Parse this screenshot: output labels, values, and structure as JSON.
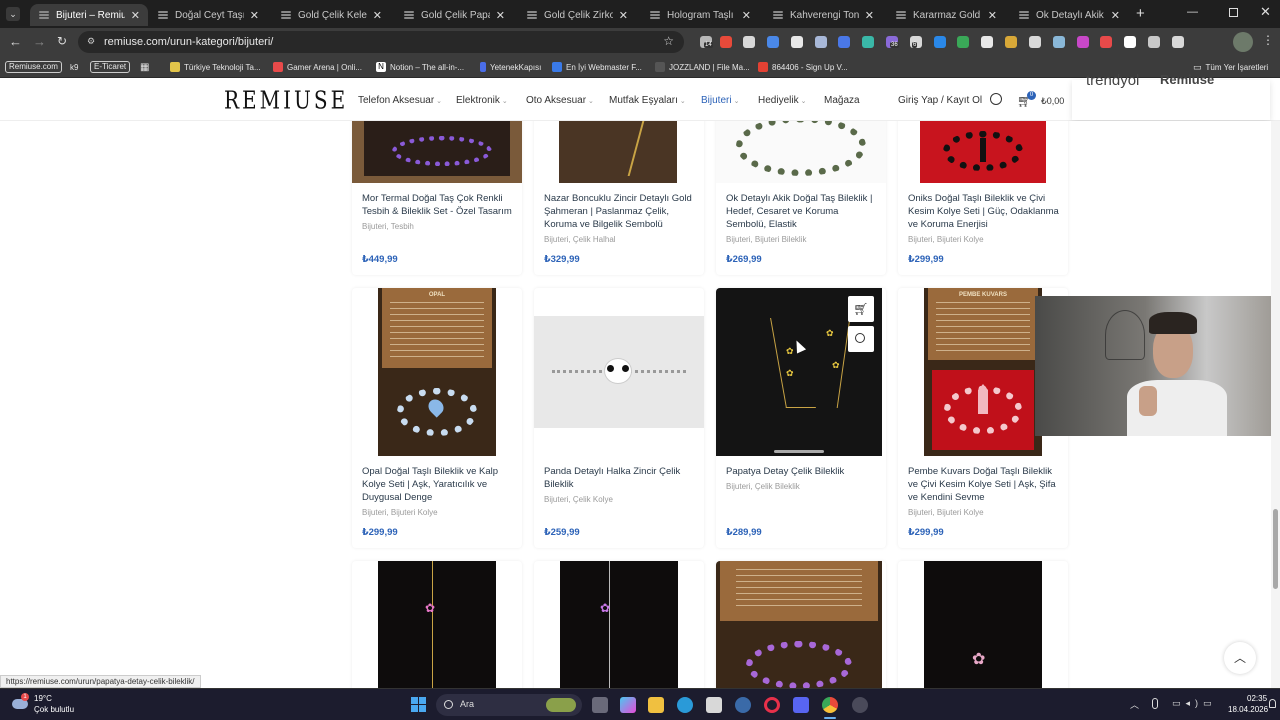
{
  "browser": {
    "tabs": [
      {
        "title": "Bijuteri – Remiuse",
        "active": true
      },
      {
        "title": "Doğal Ceyt Taşı Bilekl"
      },
      {
        "title": "Gold Çelik Kelebek Ko"
      },
      {
        "title": "Gold Çelik Papatya ve"
      },
      {
        "title": "Gold Çelik Zirkon Taş"
      },
      {
        "title": "Hologram Taşlı Kalpli"
      },
      {
        "title": "Kahverengi Tonlu Akik"
      },
      {
        "title": "Kararmaz Gold Çelik"
      },
      {
        "title": "Ok Detaylı Akik Doğ"
      }
    ],
    "url": "remiuse.com/urun-kategori/bijuteri/",
    "ext_badge_1": "14",
    "ext_badge_2": "6",
    "ext_badge_3": "36",
    "bookmarks": [
      "Remiuse.com",
      "k9",
      "E-Ticaret",
      "Türkiye Teknoloji Ta...",
      "Gamer Arena | Onli...",
      "Notion – The all-in-...",
      "YetenekKapısı",
      "En İyi Webmaster F...",
      "JOZZLAND | File Ma...",
      "864406 - Sign Up V..."
    ],
    "all_bookmarks": "Tüm Yer İşaretleri",
    "status_url": "https://remiuse.com/urun/papatya-detay-celik-bileklik/"
  },
  "site": {
    "logo": "REMIUSE",
    "nav": [
      "Telefon Aksesuar",
      "Elektronik",
      "Oto Aksesuar",
      "Mutfak Eşyaları",
      "Bijuteri",
      "Hediyelik",
      "Mağaza"
    ],
    "login": "Giriş Yap / Kayıt Ol",
    "cart_total": "₺0,00",
    "cart_count": "0",
    "overlay_brand": "trendyol",
    "overlay_brand2": "Remiuse",
    "accent": "#2d63b8"
  },
  "products": {
    "row1": [
      {
        "title": "Mor Termal Doğal Taş Çok Renkli Tesbih & Bileklik Set - Özel Tasarım",
        "cats": "Bijuteri, Tesbih",
        "price": "₺449,99"
      },
      {
        "title": "Nazar Boncuklu Zincir Detaylı Gold Şahmeran | Paslanmaz Çelik, Koruma ve Bilgelik Sembolü",
        "cats": "Bijuteri, Çelik Halhal",
        "price": "₺329,99"
      },
      {
        "title": "Ok Detaylı Akik Doğal Taş Bileklik | Hedef, Cesaret ve Koruma Sembolü, Elastik",
        "cats": "Bijuteri, Bijuteri Bileklik",
        "price": "₺269,99"
      },
      {
        "title": "Oniks Doğal Taşlı Bileklik ve Çivi Kesim Kolye Seti | Güç, Odaklanma ve Koruma Enerjisi",
        "cats": "Bijuteri, Bijuteri Kolye",
        "price": "₺299,99"
      }
    ],
    "row2": [
      {
        "title": "Opal Doğal Taşlı Bileklik ve Kalp Kolye Seti | Aşk, Yaratıcılık ve Duygusal Denge",
        "cats": "Bijuteri, Bijuteri Kolye",
        "price": "₺299,99"
      },
      {
        "title": "Panda Detaylı Halka Zincir Çelik Bileklik",
        "cats": "Bijuteri, Çelik Kolye",
        "price": "₺259,99"
      },
      {
        "title": "Papatya Detay Çelik Bileklik",
        "cats": "Bijuteri, Çelik Bileklik",
        "price": "₺289,99"
      },
      {
        "title": "Pembe Kuvars Doğal Taşlı Bileklik ve Çivi Kesim Kolye Seti | Aşk, Şifa ve Kendini Sevme",
        "cats": "Bijuteri, Bijuteri Kolye",
        "price": "₺299,99"
      }
    ],
    "box_opal_title": "OPAL",
    "box_pink_title": "PEMBE KUVARS"
  },
  "taskbar": {
    "temp": "19°C",
    "weather": "Çok bulutlu",
    "search": "Ara",
    "time": "02:35",
    "date": "18.04.2026",
    "weather_badge": "1"
  }
}
